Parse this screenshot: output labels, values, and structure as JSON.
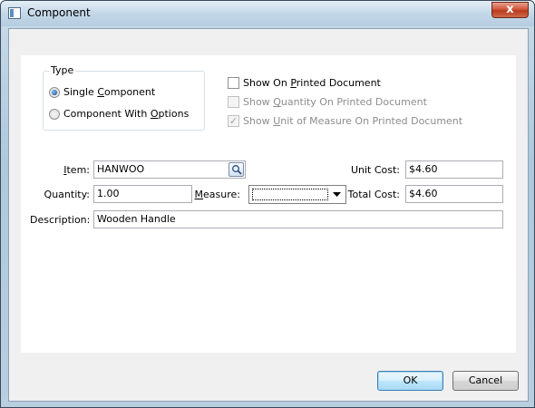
{
  "window": {
    "title": "Component",
    "close_glyph": "x"
  },
  "type_group": {
    "legend": "Type",
    "options": [
      {
        "label_pre": "Single ",
        "label_ul": "C",
        "label_post": "omponent",
        "checked": true
      },
      {
        "label_pre": "Component With ",
        "label_ul": "O",
        "label_post": "ptions",
        "checked": false
      }
    ]
  },
  "print_options": [
    {
      "label_pre": "Show On ",
      "label_ul": "P",
      "label_post": "rinted Document",
      "checked": false,
      "enabled": true
    },
    {
      "label_pre": "Show ",
      "label_ul": "Q",
      "label_post": "uantity On Printed Document",
      "checked": false,
      "enabled": false
    },
    {
      "label_pre": "Show ",
      "label_ul": "U",
      "label_post": "nit of Measure On Printed Document",
      "checked": true,
      "enabled": false
    }
  ],
  "fields": {
    "item": {
      "label_ul": "I",
      "label_post": "tem:",
      "value": "HANWOO"
    },
    "quantity": {
      "label": "Quantity:",
      "value": "1.00"
    },
    "measure": {
      "label_ul": "M",
      "label_post": "easure:",
      "value": ""
    },
    "unit_cost": {
      "label": "Unit Cost:",
      "value": "$4.60"
    },
    "total_cost": {
      "label": "Total Cost:",
      "value": "$4.60"
    },
    "description": {
      "label": "Description:",
      "value": "Wooden Handle"
    }
  },
  "buttons": {
    "ok": "OK",
    "cancel": "Cancel"
  },
  "icons": {
    "lookup": "magnifier-icon",
    "dropdown": "chevron-down-icon",
    "window": "window-icon",
    "check_glyph": "✓"
  }
}
